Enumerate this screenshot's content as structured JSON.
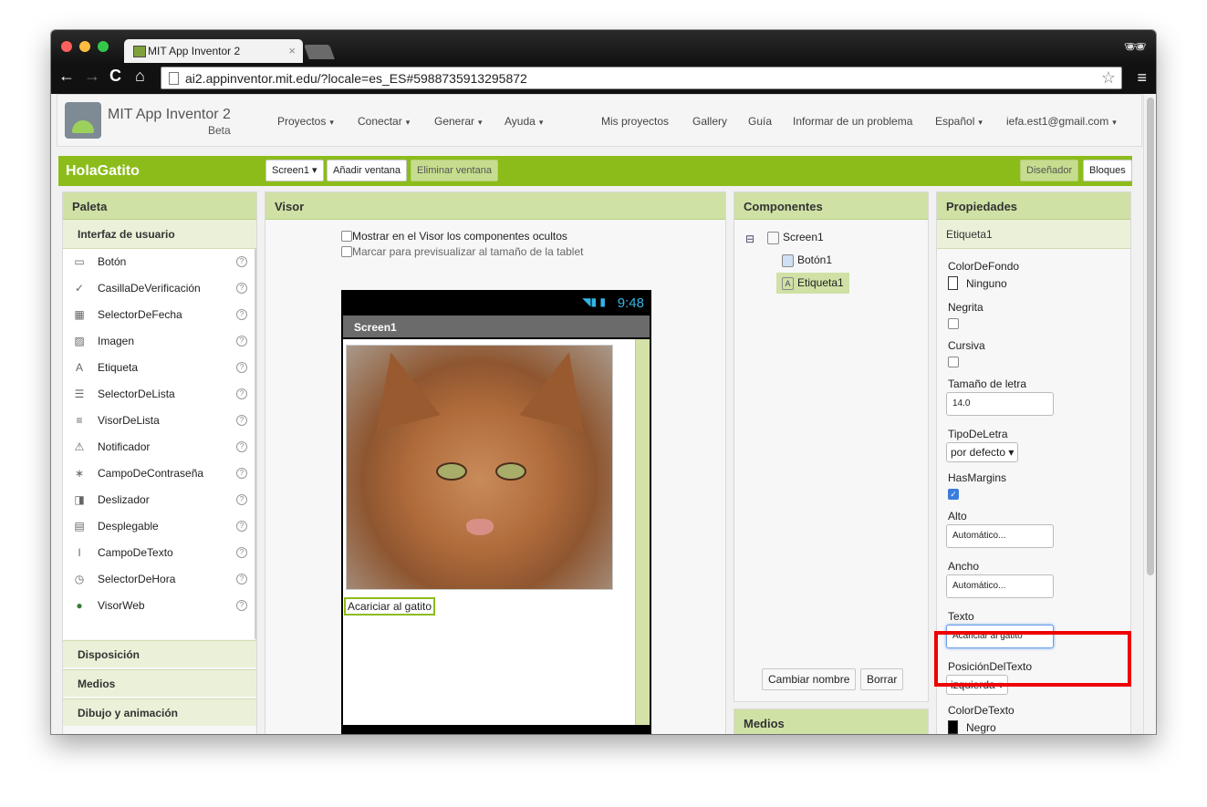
{
  "browser": {
    "tab_title": "MIT App Inventor 2",
    "tab_close": "×",
    "url": "ai2.appinventor.mit.edu/?locale=es_ES#5988735913295872",
    "icons": {
      "back": "←",
      "forward": "→",
      "reload": "C",
      "home": "⌂",
      "star": "☆",
      "menu": "≡",
      "incognito": "🕶"
    }
  },
  "app": {
    "logo_title": "MIT App Inventor 2",
    "logo_beta": "Beta",
    "nav": {
      "proyectos": "Proyectos",
      "conectar": "Conectar",
      "generar": "Generar",
      "ayuda": "Ayuda",
      "mis_proyectos": "Mis proyectos",
      "gallery": "Gallery",
      "guia": "Guía",
      "informar": "Informar de un problema",
      "idioma": "Español",
      "user": "iefa.est1@gmail.com"
    },
    "caret": "▾"
  },
  "project": {
    "name": "HolaGatito",
    "screen_select": "Screen1 ▾",
    "add_screen": "Añadir ventana",
    "remove_screen": "Eliminar ventana",
    "designer": "Diseñador",
    "blocks": "Bloques"
  },
  "palette": {
    "title": "Paleta",
    "subcategory": "Interfaz de usuario",
    "items": [
      {
        "label": "Botón",
        "icon": "▭"
      },
      {
        "label": "CasillaDeVerificación",
        "icon": "✓"
      },
      {
        "label": "SelectorDeFecha",
        "icon": "▦"
      },
      {
        "label": "Imagen",
        "icon": "▨"
      },
      {
        "label": "Etiqueta",
        "icon": "A"
      },
      {
        "label": "SelectorDeLista",
        "icon": "☰"
      },
      {
        "label": "VisorDeLista",
        "icon": "≡"
      },
      {
        "label": "Notificador",
        "icon": "⚠"
      },
      {
        "label": "CampoDeContraseña",
        "icon": "∗"
      },
      {
        "label": "Deslizador",
        "icon": "◨"
      },
      {
        "label": "Desplegable",
        "icon": "▤"
      },
      {
        "label": "CampoDeTexto",
        "icon": "I"
      },
      {
        "label": "SelectorDeHora",
        "icon": "◷"
      },
      {
        "label": "VisorWeb",
        "icon": "●"
      }
    ],
    "help": "?",
    "categories": [
      "Disposición",
      "Medios",
      "Dibujo y animación"
    ]
  },
  "viewer": {
    "title": "Visor",
    "show_hidden": "Mostrar en el Visor los componentes ocultos",
    "tablet_preview": "Marcar para previsualizar al tamaño de la tablet",
    "clock": "9:48",
    "screen_title": "Screen1",
    "label_text": "Acariciar al gatito",
    "nav_icons": {
      "back": "↩",
      "home": "⌂",
      "recent": "▭"
    }
  },
  "components": {
    "title": "Componentes",
    "collapse": "⊟",
    "tree": [
      "Screen1",
      "Botón1",
      "Etiqueta1"
    ],
    "rename": "Cambiar nombre",
    "delete": "Borrar",
    "media_title": "Medios"
  },
  "properties": {
    "title": "Propiedades",
    "component": "Etiqueta1",
    "bg_color_label": "ColorDeFondo",
    "bg_color_value": "Ninguno",
    "bold_label": "Negrita",
    "italic_label": "Cursiva",
    "font_size_label": "Tamaño de letra",
    "font_size_value": "14.0",
    "font_type_label": "TipoDeLetra",
    "font_type_value": "por defecto ▾",
    "has_margins_label": "HasMargins",
    "height_label": "Alto",
    "height_value": "Automático...",
    "width_label": "Ancho",
    "width_value": "Automático...",
    "text_label": "Texto",
    "text_value": "Acariciar al gatito",
    "text_align_label": "PosiciónDelTexto",
    "text_align_value": "izquierda ▾",
    "text_color_label": "ColorDeTexto",
    "text_color_value": "Negro"
  },
  "colors": {
    "accent_green": "#8cbc1a",
    "highlight_red": "#ee0000",
    "header_green": "#cfe1a5",
    "checked_blue": "#3b7ddd"
  }
}
